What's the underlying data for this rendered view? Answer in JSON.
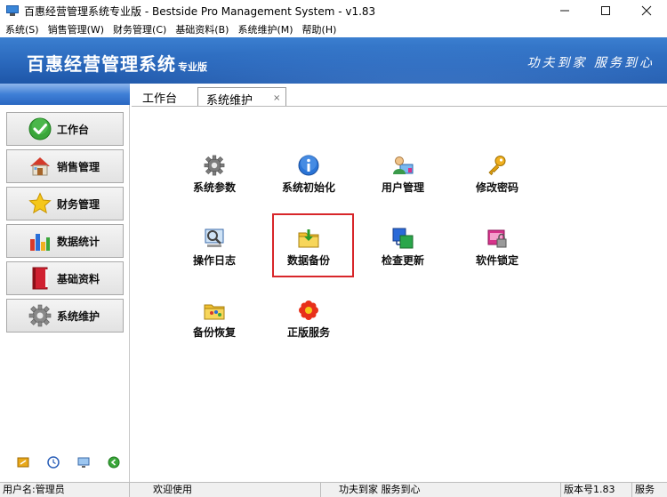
{
  "window": {
    "title": "百惠经营管理系统专业版 - Bestside Pro Management System - v1.83",
    "controls": [
      "minimize",
      "maximize",
      "close"
    ]
  },
  "menubar": {
    "items": [
      {
        "label": "系统(S)"
      },
      {
        "label": "销售管理(W)"
      },
      {
        "label": "财务管理(C)"
      },
      {
        "label": "基础资料(B)"
      },
      {
        "label": "系统维护(M)"
      },
      {
        "label": "帮助(H)"
      }
    ]
  },
  "banner": {
    "title": "百惠经营管理系统",
    "edition": "专业版",
    "slogan": "功夫到家 服务到心"
  },
  "sidebar": {
    "items": [
      {
        "label": "工作台",
        "icon": "check-icon"
      },
      {
        "label": "销售管理",
        "icon": "house-icon"
      },
      {
        "label": "财务管理",
        "icon": "star-icon"
      },
      {
        "label": "数据统计",
        "icon": "bar-chart-icon"
      },
      {
        "label": "基础资料",
        "icon": "book-icon"
      },
      {
        "label": "系统维护",
        "icon": "gear-icon"
      }
    ],
    "bottom_icons": [
      "key-icon",
      "clock-icon",
      "monitor-icon",
      "back-arrow-icon"
    ]
  },
  "tabs": {
    "home": "工作台",
    "active": "系统维护",
    "close_symbol": "×"
  },
  "tiles": [
    {
      "label": "系统参数",
      "icon": "gear-icon"
    },
    {
      "label": "系统初始化",
      "icon": "info-icon"
    },
    {
      "label": "用户管理",
      "icon": "user-icon"
    },
    {
      "label": "修改密码",
      "icon": "key-icon"
    },
    {
      "label": "操作日志",
      "icon": "log-icon"
    },
    {
      "label": "数据备份",
      "icon": "folder-download-icon",
      "highlighted": true
    },
    {
      "label": "检查更新",
      "icon": "update-icon"
    },
    {
      "label": "软件锁定",
      "icon": "lock-icon"
    },
    {
      "label": "备份恢复",
      "icon": "folder-restore-icon"
    },
    {
      "label": "正版服务",
      "icon": "flower-icon"
    }
  ],
  "statusbar": {
    "user": "用户名:管理员",
    "welcome": "欢迎使用",
    "slogan": "功夫到家 服务到心",
    "version": "版本号1.83",
    "service": "服务"
  },
  "colors": {
    "banner": "#2a68bc",
    "highlight_border": "#d8262a",
    "sidebar_header": "#3f7fd6"
  }
}
